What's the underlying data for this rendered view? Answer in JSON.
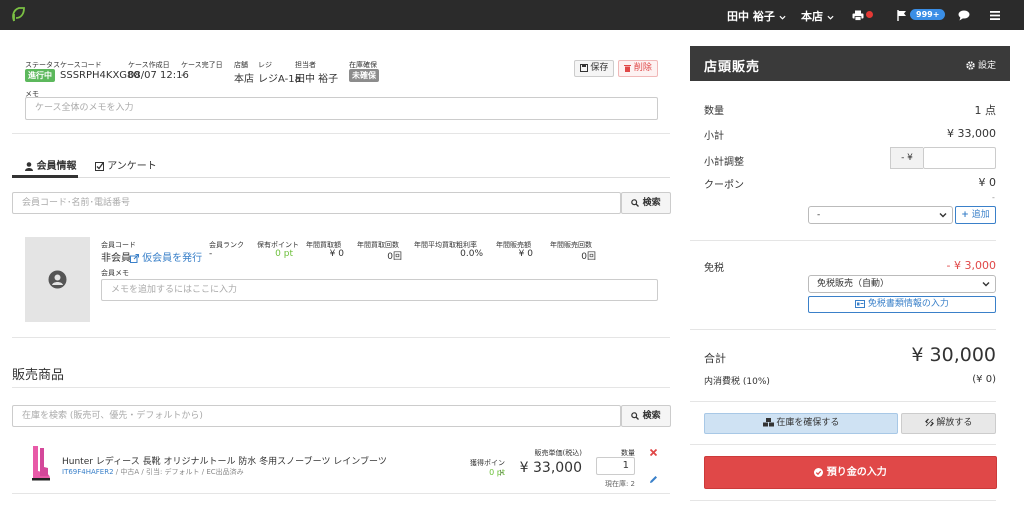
{
  "topbar": {
    "user": "田中 裕子",
    "store": "本店",
    "notification_count": "999+"
  },
  "case": {
    "status_label": "ステータス",
    "status_value": "進行中",
    "code_label": "ケースコード",
    "code_value": "SSSRPH4KXG80",
    "created_label": "ケース作成日",
    "created_value": "08/07 12:16",
    "completed_label": "ケース完了日",
    "completed_value": "-",
    "store_label": "店舗",
    "store_value": "本店",
    "register_label": "レジ",
    "register_value": "レジA-1a",
    "staff_label": "担当者",
    "staff_value": "田中 裕子",
    "stock_label": "在庫確保",
    "stock_value": "未確保",
    "save_label": "保存",
    "delete_label": "削除",
    "memo_label": "メモ",
    "memo_placeholder": "ケース全体のメモを入力"
  },
  "tabs": {
    "member": "会員情報",
    "survey": "アンケート"
  },
  "member": {
    "search_placeholder": "会員コード･名前･電話番号",
    "search_button": "検索",
    "code_label": "会員コード",
    "code_value": "非会員",
    "issue_link": "仮会員を発行",
    "rank_label": "会員ランク",
    "rank_value": "-",
    "points_label": "保有ポイント",
    "points_value": "0 pt",
    "annual_purchase_label": "年間買取額",
    "annual_purchase_value": "¥ 0",
    "annual_purchase_count_label": "年間買取回数",
    "annual_purchase_count_value": "0回",
    "annual_margin_label": "年間平均買取粗利率",
    "annual_margin_value": "0.0%",
    "annual_sales_label": "年間販売額",
    "annual_sales_value": "¥ 0",
    "annual_sales_count_label": "年間販売回数",
    "annual_sales_count_value": "0回",
    "memo_label": "会員メモ",
    "memo_placeholder": "メモを追加するにはここに入力"
  },
  "products": {
    "title": "販売商品",
    "search_placeholder": "在庫を検索 (販売可、優先・デフォルトから)",
    "search_button": "検索",
    "items": [
      {
        "name": "Hunter レディース 長靴 オリジナルトール 防水 冬用スノーブーツ レインブーツ",
        "sku": "IT69F4HAFER2",
        "meta": " / 中古A / 引当: デフォルト / EC出品済み",
        "points_label": "獲得ポイント",
        "points_value": "0 pt",
        "price_label": "販売単価(税込)",
        "price_value": "¥ 33,000",
        "qty_label": "数量",
        "qty_value": "1",
        "stock_note": "現在庫: 2"
      }
    ]
  },
  "register": {
    "title": "店頭販売",
    "settings_label": "設定",
    "qty_label": "数量",
    "qty_value": "1 点",
    "subtotal_label": "小計",
    "subtotal_value": "¥ 33,000",
    "adjust_label": "小計調整",
    "adjust_prefix": "- ¥",
    "adjust_value": "",
    "coupon_label": "クーポン",
    "coupon_value": "¥ 0",
    "coupon_sub": "-",
    "coupon_select": "-",
    "add_label": "追加",
    "tax_free_label": "免税",
    "tax_free_value": "- ¥ 3,000",
    "tax_free_select": "免税販売（自動）",
    "tax_doc_button": "免税書類情報の入力",
    "total_label": "合計",
    "total_value": "¥ 30,000",
    "inner_tax_label": "内消費税 (10%)",
    "inner_tax_value": "(¥ 0)",
    "reserve_button": "在庫を確保する",
    "release_button": "解放する",
    "deposit_button": "預り金の入力"
  },
  "colors": {
    "status_green": "#5cb85c",
    "stock_gray": "#8c8c8c",
    "danger_red": "#e04848",
    "link_blue": "#3a80c9",
    "point_green": "#6cbf3a",
    "header_dark": "#3a3a3a"
  }
}
